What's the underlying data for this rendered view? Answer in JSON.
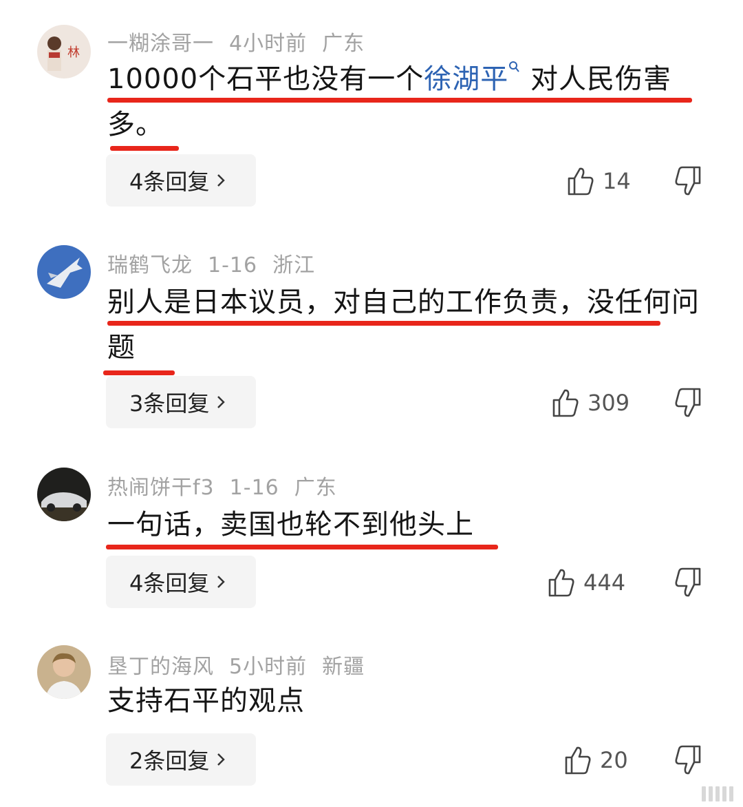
{
  "colors": {
    "username": "#a2a2a2",
    "body_text": "#151515",
    "link": "#2d63b3",
    "underline": "#e8261b",
    "reply_bg": "#f4f4f4"
  },
  "icons": {
    "like": "thumbs-up-icon",
    "dislike": "thumbs-down-icon",
    "reply_chevron": "chevron-right-icon",
    "search_mark": "search-icon"
  },
  "comments": [
    {
      "username": "一糊涂哥一",
      "time": "4小时前",
      "location": "广东",
      "text_before": "10000个石平也没有一个",
      "link": "徐湖平",
      "text_after": " 对人民伤害多。",
      "replies": "4条回复",
      "likes": "14"
    },
    {
      "username": "瑞鹤飞龙",
      "time": "1-16",
      "location": "浙江",
      "text": "别人是日本议员，对自己的工作负责，没任何问题",
      "replies": "3条回复",
      "likes": "309"
    },
    {
      "username": "热闹饼干f3",
      "time": "1-16",
      "location": "广东",
      "text": "一句话，卖国也轮不到他头上",
      "replies": "4条回复",
      "likes": "444"
    },
    {
      "username": "垦丁的海风",
      "time": "5小时前",
      "location": "新疆",
      "text": "支持石平的观点",
      "replies": "2条回复",
      "likes": "20"
    }
  ]
}
